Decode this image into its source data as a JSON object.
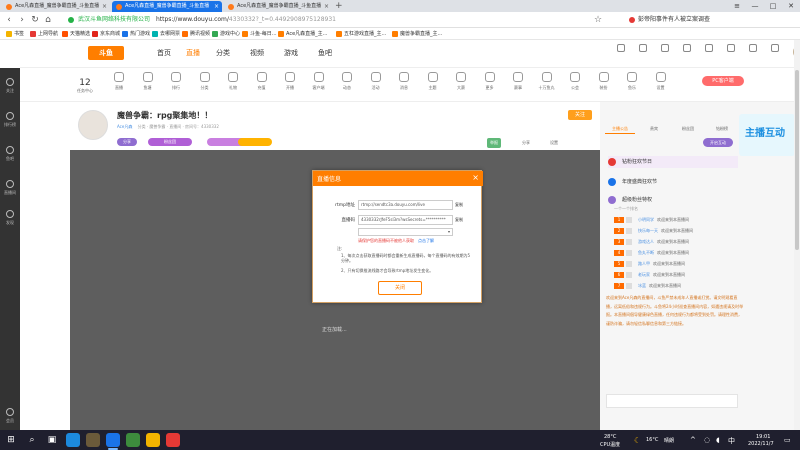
{
  "browser": {
    "tabs": [
      {
        "title": "Ace凡森直播_魔兽争霸直播_斗鱼直播"
      },
      {
        "title": "Ace凡森直播_魔兽争霸直播_斗鱼直播"
      },
      {
        "title": "Ace凡森直播_魔兽争霸直播_斗鱼直播"
      }
    ],
    "new_tab": "+",
    "window_controls": {
      "menu": "≡",
      "minimize": "—",
      "maximize": "□",
      "close": "✕"
    },
    "nav": {
      "back": "‹",
      "forward": "›",
      "reload": "↻",
      "home": "⌂",
      "star": "☆"
    },
    "address": {
      "site_label": "武汉斗鱼网络科技有限公司",
      "url_host": "https://www.douyu.com/",
      "url_path": "4330332?_t=0.4492908975128931"
    },
    "news_ticker": "彭帝阳事件有人被立案调查",
    "bookmarks": [
      {
        "label": "书签",
        "color": "#f4b400"
      },
      {
        "label": "上网导航",
        "color": "#e53935"
      },
      {
        "label": "天猫精选",
        "color": "#ff5000"
      },
      {
        "label": "京东商城",
        "color": "#e1251b"
      },
      {
        "label": "热门游戏",
        "color": "#1a73e8"
      },
      {
        "label": "去哪网票",
        "color": "#00b3b0"
      },
      {
        "label": "腾讯视频",
        "color": "#ff6d00"
      },
      {
        "label": "游戏中心",
        "color": "#34a853"
      },
      {
        "label": "斗鱼-每日...",
        "color": "#ff7e00"
      },
      {
        "label": "Ace凡森直播_主...",
        "color": "#ff7e00"
      },
      {
        "label": "五杠游戏直播_主...",
        "color": "#ff7e00"
      },
      {
        "label": "魔兽争霸直播_主...",
        "color": "#ff7e00"
      }
    ]
  },
  "douyu": {
    "logo": "斗鱼",
    "nav": [
      "首页",
      "直播",
      "分类",
      "视频",
      "游戏",
      "鱼吧"
    ],
    "nav_active": 1,
    "left_sidebar": [
      "关注",
      "排行榜",
      "鱼吧",
      "直播间",
      "发现",
      "会员"
    ],
    "tools_count": "12",
    "tools_count_label": "任务中心",
    "tools": [
      "直播",
      "鱼塘",
      "排行",
      "分类",
      "礼物",
      "充值",
      "开播",
      "客户端",
      "动态",
      "活动",
      "消息",
      "主题",
      "大赛",
      "更多",
      "赛事",
      "十万鱼丸",
      "公会",
      "装扮",
      "鱼乐",
      "设置"
    ],
    "pc_client": "PC客户端",
    "room": {
      "title": "魔兽争霸：rpg聚集地！！",
      "streamer": "Ace凡森",
      "sub": "分类 · 魔兽争霸 · 直播间 · 房间号：4330332",
      "chips": [
        "分享",
        "粉丝团"
      ],
      "follow": "关注",
      "actions": [
        "举报",
        "分享",
        "设置"
      ],
      "loading": "正在加载..."
    },
    "side": {
      "tabs": [
        "主播公告",
        "贵宾",
        "粉丝团",
        "钻粉榜"
      ],
      "active_tab": 0,
      "promo_text": "主播互动",
      "btn": "开启互动",
      "rows": [
        {
          "label": "钻粉狂欢节日",
          "color": "#e53935"
        },
        {
          "label": "年度盛典狂欢节",
          "color": "#1a73e8"
        },
        {
          "label": "超级粉丝特权",
          "color": "#8f6dd0"
        }
      ],
      "rank_head": "一个一个排名",
      "ranks": [
        {
          "n": "1",
          "name": "小明同学",
          "text": "欢迎来到本直播间"
        },
        {
          "n": "2",
          "name": "快乐每一天",
          "text": "欢迎来到本直播间"
        },
        {
          "n": "3",
          "name": "游戏达人",
          "text": "欢迎来到本直播间"
        },
        {
          "n": "4",
          "name": "鱼丸不断",
          "text": "欢迎来到本直播间"
        },
        {
          "n": "5",
          "name": "路人甲",
          "text": "欢迎来到本直播间"
        },
        {
          "n": "6",
          "name": "老玩家",
          "text": "欢迎来到本直播间"
        },
        {
          "n": "7",
          "name": "冰蓝",
          "text": "欢迎来到本直播间"
        }
      ],
      "chat": "欢迎来到Ace凡森的直播间，斗鱼严禁未成年人直播或打赏。请文明观看直播，远离低俗和违规行为。斗鱼将24小时巡查直播间内容，如遇违规请及时举报。本直播间倡导健康绿色直播，任何违规行为都将受到处罚。请理性消费，谨防诈骗，请勿轻信私聊信息和第三方链接。",
      "chat_placeholder": ""
    }
  },
  "modal": {
    "title": "直播信息",
    "close": "×",
    "rtmp_label": "rtmp地址",
    "rtmp_value": "rtmp://sendtc3a.douyu.com/live",
    "key_label": "直播码",
    "key_value": "4330332rJfeF5sl3m?wsSecrets=**********",
    "copy": "复制",
    "select_value": "",
    "warn": "请保护您的直播码不被他人获取",
    "link": "点击了解",
    "note_head": "注:",
    "notes": [
      "1、每次点击获取直播码时都会重新生成直播码，每个直播码的有效期为5分钟。",
      "2、只有切换推流线路才会导致rtmp地址发生变化。"
    ],
    "confirm": "关闭"
  },
  "taskbar": {
    "start": "⊞",
    "weather": "28°C",
    "weather_sub": "CPU温度",
    "temp": "16°C",
    "temp_sub": "晴朗",
    "time": "19:01",
    "date": "2022/11/7"
  }
}
